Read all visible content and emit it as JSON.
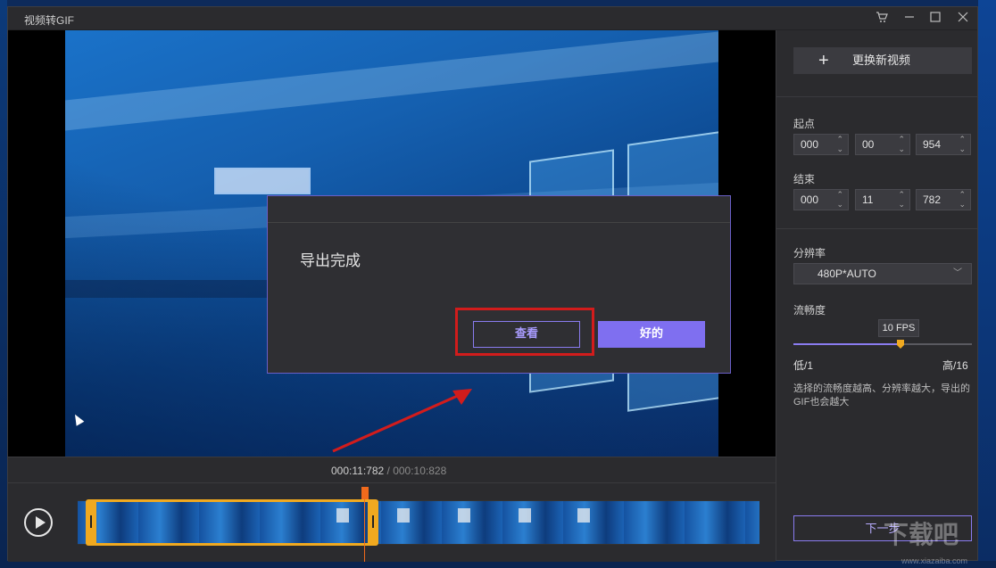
{
  "window": {
    "title": "视频转GIF"
  },
  "dialog": {
    "message": "导出完成",
    "view_label": "查看",
    "ok_label": "好的"
  },
  "timeline": {
    "current_time": "000:11:782",
    "separator": " / ",
    "total_time": "000:10:828"
  },
  "panel": {
    "replace_label": "更换新视频",
    "start_label": "起点",
    "start": [
      "000",
      "00",
      "954"
    ],
    "end_label": "结束",
    "end": [
      "000",
      "11",
      "782"
    ],
    "resolution_label": "分辨率",
    "resolution_value": "480P*AUTO",
    "fluency_label": "流畅度",
    "fps_value": "10 FPS",
    "fluency_level": 0.6,
    "low_label": "低/1",
    "high_label": "高/16",
    "hint": "选择的流畅度越高、分辨率越大，导出的GIF也会越大",
    "next_label": "下一步"
  },
  "watermark": {
    "text": "下载吧",
    "url": "www.xiazaiba.com"
  },
  "colors": {
    "accent": "#7f6ff0",
    "range_handle": "#f0a920",
    "playhead": "#f06a1c",
    "highlight": "#d21c1c"
  }
}
